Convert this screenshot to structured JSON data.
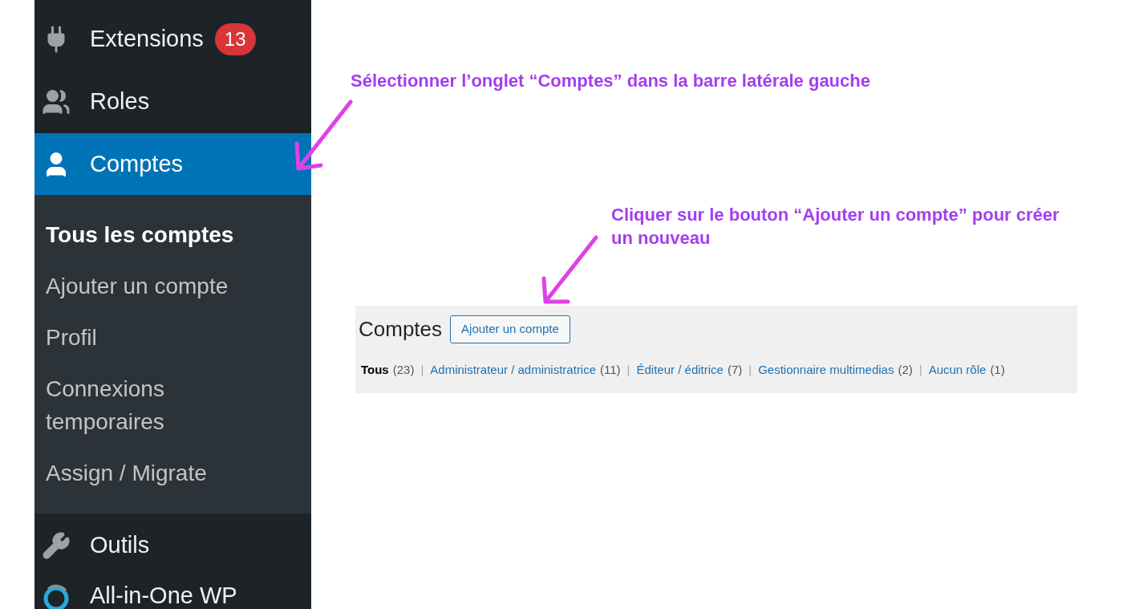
{
  "sidebar": {
    "menu": [
      {
        "label": "Extensions",
        "badge": "13",
        "selected": false
      },
      {
        "label": "Roles",
        "selected": false
      },
      {
        "label": "Comptes",
        "selected": true,
        "submenu": [
          {
            "label": "Tous les comptes",
            "selected": true
          },
          {
            "label": "Ajouter un compte",
            "selected": false
          },
          {
            "label": "Profil",
            "selected": false
          },
          {
            "label": "Connexions temporaires",
            "selected": false
          },
          {
            "label": "Assign / Migrate",
            "selected": false
          }
        ]
      },
      {
        "label": "Outils",
        "selected": false
      },
      {
        "label": "All-in-One WP",
        "selected": false
      }
    ]
  },
  "annotations": [
    {
      "text": "Sélectionner l’onglet “Comptes” dans la barre latérale gauche"
    },
    {
      "text": "Cliquer sur le bouton “Ajouter un compte” pour créer un nouveau"
    }
  ],
  "panel": {
    "title": "Comptes",
    "button": "Ajouter un compte",
    "separator": "|",
    "filters": [
      {
        "label": "Tous",
        "count": "(23)",
        "selected": true
      },
      {
        "label": "Administrateur / administratrice",
        "count": "(11)",
        "selected": false
      },
      {
        "label": "Éditeur / éditrice",
        "count": "(7)",
        "selected": false
      },
      {
        "label": "Gestionnaire multimedias",
        "count": "(2)",
        "selected": false
      },
      {
        "label": "Aucun rôle",
        "count": "(1)",
        "selected": false
      }
    ]
  }
}
